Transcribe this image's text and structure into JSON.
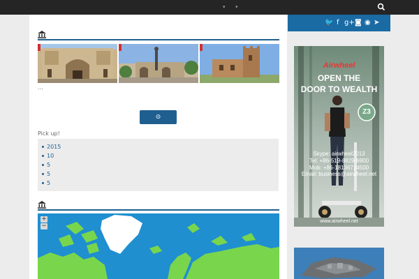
{
  "topbar": {
    "icons": [
      "chevron-down-icon",
      "chevron-down-icon",
      "search-icon"
    ]
  },
  "sections": [
    {
      "icon": "bank-icon"
    },
    {
      "icon": "bank-icon"
    }
  ],
  "main": {
    "ellipsis": "…",
    "more_button_icon": "⊝",
    "pickup_label": "Pick up!",
    "pickup_items": [
      "2015",
      "10",
      "5",
      "5",
      "5"
    ]
  },
  "map": {
    "zoom_in": "+",
    "zoom_out": "−"
  },
  "sidebar": {
    "social_icons": [
      "twitter-icon",
      "facebook-icon",
      "google-plus-icon",
      "instagram-icon",
      "rss-icon",
      "telegram-icon"
    ],
    "social_glyphs": [
      "🐦",
      "f",
      "g+",
      "◙",
      "◉",
      "➤"
    ],
    "ad": {
      "brand": "Airwheel",
      "headline_1": "OPEN THE",
      "headline_2": "DOOR TO WEALTH",
      "model": "Z3",
      "skype": "Skype: airwheel2013",
      "tel": "Tel: +86-519-8829-6900",
      "mob": "Mob: +86-18136714500",
      "email": "Email: business@airwheel.net",
      "url": "www.airwheel.net"
    }
  },
  "colors": {
    "accent": "#1f5f8f",
    "topbar": "#252525",
    "social_bar": "#1a6aa3",
    "tag_red": "#d32f2f",
    "map_land": "#79d64c",
    "map_sea": "#1f8fd0"
  }
}
